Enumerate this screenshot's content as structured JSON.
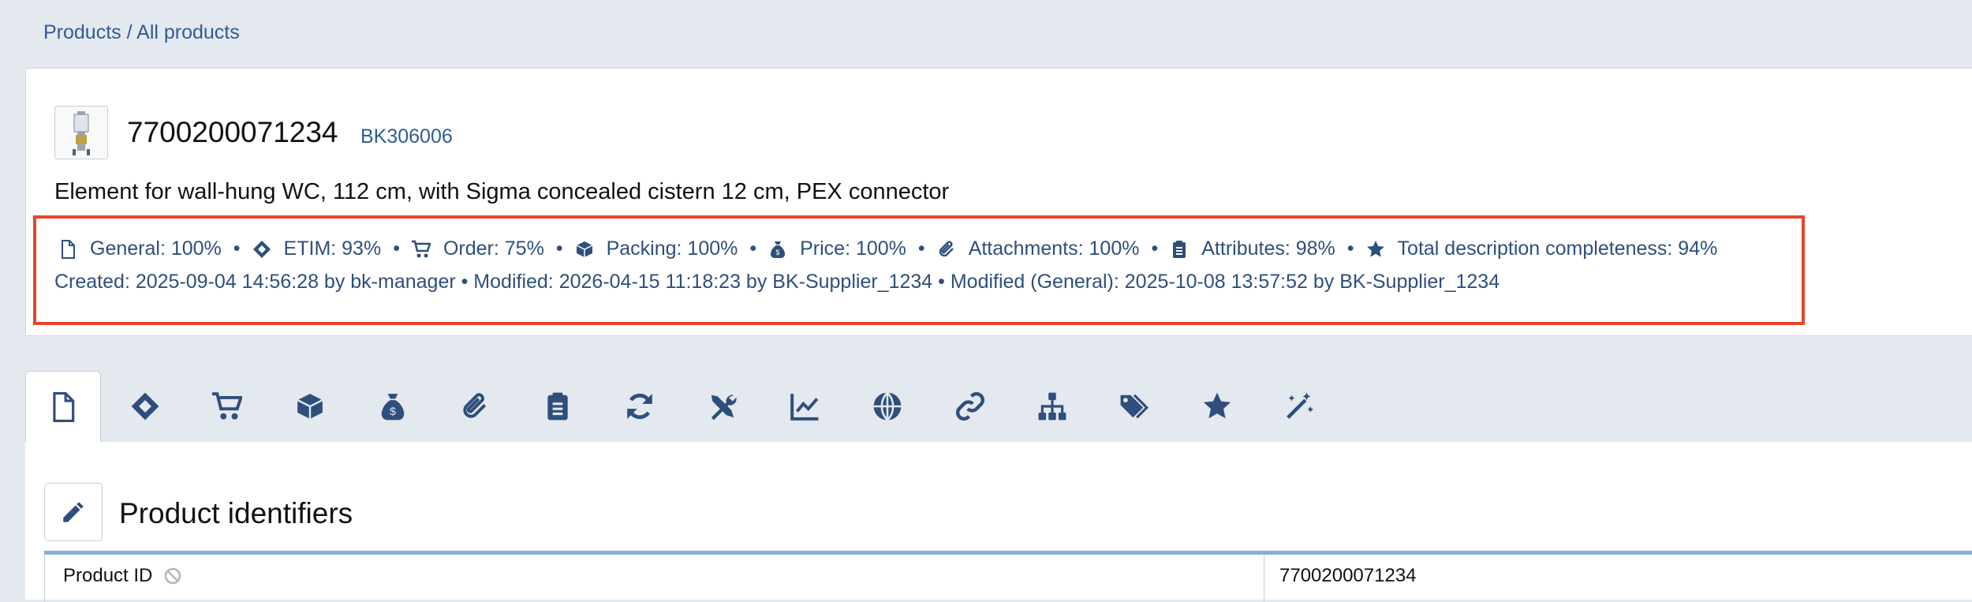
{
  "breadcrumb": {
    "products": "Products",
    "separator": " / ",
    "all_products": "All products"
  },
  "product": {
    "id": "7700200071234",
    "supplier_id": "BK306006",
    "description": "Element for wall-hung WC, 112 cm, with Sigma concealed cistern 12 cm, PEX connector",
    "thumbnail_icon": "wc-frame-thumbnail"
  },
  "completeness": [
    {
      "icon": "file-icon",
      "label": "General: 100%"
    },
    {
      "icon": "etim-icon",
      "label": "ETIM: 93%"
    },
    {
      "icon": "cart-icon",
      "label": "Order: 75%"
    },
    {
      "icon": "box-icon",
      "label": "Packing: 100%"
    },
    {
      "icon": "money-bag-icon",
      "label": "Price: 100%"
    },
    {
      "icon": "paperclip-icon",
      "label": "Attachments: 100%"
    },
    {
      "icon": "clipboard-icon",
      "label": "Attributes: 98%"
    },
    {
      "icon": "star-icon",
      "label": "Total description completeness: 94%"
    }
  ],
  "audit": {
    "line": "Created: 2025-09-04 14:56:28 by bk-manager  •  Modified: 2026-04-15 11:18:23 by BK-Supplier_1234  •  Modified (General): 2025-10-08 13:57:52 by BK-Supplier_1234"
  },
  "tabs": [
    {
      "icon": "file-icon",
      "active": true
    },
    {
      "icon": "etim-icon"
    },
    {
      "icon": "cart-icon"
    },
    {
      "icon": "box-icon"
    },
    {
      "icon": "money-bag-icon"
    },
    {
      "icon": "paperclip-icon"
    },
    {
      "icon": "clipboard-icon"
    },
    {
      "icon": "sync-icon"
    },
    {
      "icon": "tools-icon"
    },
    {
      "icon": "chart-line-icon"
    },
    {
      "icon": "globe-icon"
    },
    {
      "icon": "link-icon"
    },
    {
      "icon": "sitemap-icon"
    },
    {
      "icon": "tags-icon"
    },
    {
      "icon": "star-icon"
    },
    {
      "icon": "magic-wand-icon"
    }
  ],
  "section": {
    "title": "Product identifiers",
    "edit_icon": "pencil-icon",
    "rows": [
      {
        "label": "Product ID",
        "value": "7700200071234",
        "locked_icon": "ban-icon"
      }
    ]
  },
  "colors": {
    "accent": "#2e4f7c",
    "link": "#2f5c93",
    "highlight_border": "#e8452a",
    "background": "#e4e8ef"
  }
}
